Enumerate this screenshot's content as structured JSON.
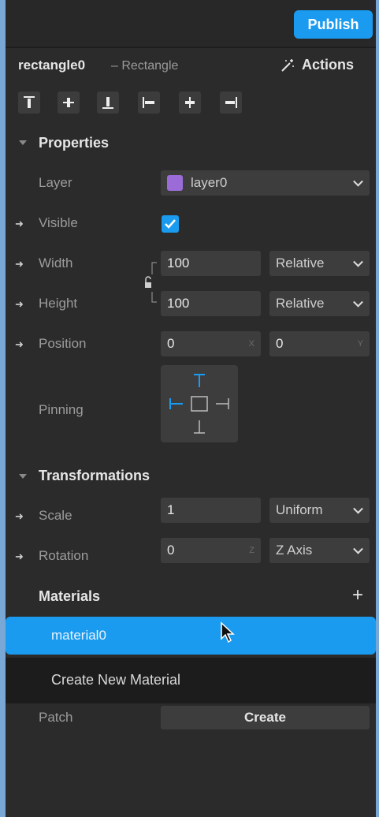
{
  "header": {
    "publish_label": "Publish",
    "object_name": "rectangle0",
    "object_type": "– Rectangle",
    "actions_label": "Actions"
  },
  "alignment_buttons": [
    "align-top-icon",
    "align-vertical-center-icon",
    "align-bottom-icon",
    "align-left-icon",
    "align-horizontal-center-icon",
    "align-right-icon"
  ],
  "properties": {
    "section_title": "Properties",
    "layer_label": "Layer",
    "layer_value": "layer0",
    "layer_color": "#9b6cd8",
    "visible_label": "Visible",
    "visible_checked": true,
    "width_label": "Width",
    "width_value": "100",
    "width_mode": "Relative",
    "height_label": "Height",
    "height_value": "100",
    "height_mode": "Relative",
    "position_label": "Position",
    "position_x": "0",
    "position_x_axis": "X",
    "position_y": "0",
    "position_y_axis": "Y",
    "pinning_label": "Pinning"
  },
  "transformations": {
    "section_title": "Transformations",
    "scale_label": "Scale",
    "scale_value": "1",
    "scale_mode": "Uniform",
    "rotation_label": "Rotation",
    "rotation_value": "0",
    "rotation_axis_hint": "Z",
    "rotation_axis": "Z Axis"
  },
  "materials": {
    "section_title": "Materials",
    "add_icon": "plus-icon",
    "selected_item": "material0",
    "dropdown_item": "Create New Material"
  },
  "patch": {
    "label": "Patch",
    "button_label": "Create"
  },
  "colors": {
    "accent": "#1a9bf0",
    "panel_bg": "#2b2b2c",
    "page_bg": "#7aa8d6"
  }
}
